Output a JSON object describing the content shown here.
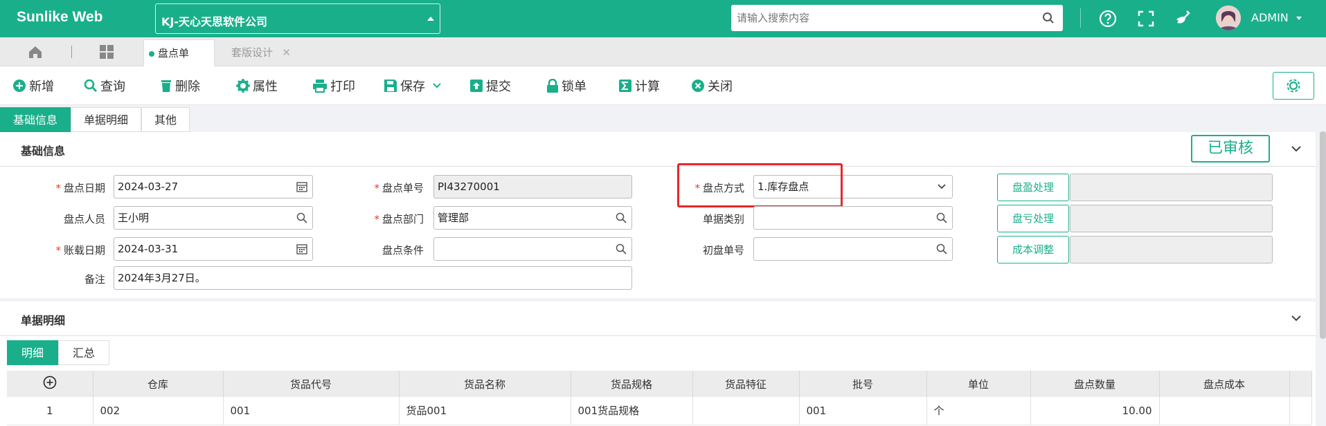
{
  "header": {
    "brand": "Sunlike Web",
    "company": "KJ-天心天思软件公司",
    "search_placeholder": "请输入搜索内容",
    "user": "ADMIN"
  },
  "tabs": [
    {
      "label": "盘点单"
    },
    {
      "label": "套版设计"
    }
  ],
  "toolbar": {
    "new": "新增",
    "query": "查询",
    "delete": "删除",
    "properties": "属性",
    "print": "打印",
    "save": "保存",
    "submit": "提交",
    "lock": "锁单",
    "calc": "计算",
    "close": "关闭"
  },
  "section_tabs": [
    "基础信息",
    "单据明细",
    "其他"
  ],
  "basic": {
    "title": "基础信息",
    "status": "已审核",
    "fields": {
      "count_date": {
        "label": "盘点日期",
        "value": "2024-03-27"
      },
      "count_no": {
        "label": "盘点单号",
        "value": "PI43270001"
      },
      "count_method": {
        "label": "盘点方式",
        "value": "1.库存盘点"
      },
      "counter": {
        "label": "盘点人员",
        "value": "王小明"
      },
      "count_dept": {
        "label": "盘点部门",
        "value": "管理部"
      },
      "doc_type": {
        "label": "单据类别",
        "value": ""
      },
      "post_date": {
        "label": "账载日期",
        "value": "2024-03-31"
      },
      "condition": {
        "label": "盘点条件",
        "value": ""
      },
      "initial_no": {
        "label": "初盘单号",
        "value": ""
      },
      "remark": {
        "label": "备注",
        "value": "2024年3月27日。"
      }
    },
    "buttons": {
      "surplus": "盘盈处理",
      "loss": "盘亏处理",
      "cost": "成本调整"
    }
  },
  "detail": {
    "title": "单据明细",
    "subtabs": [
      "明细",
      "汇总"
    ],
    "columns": [
      "仓库",
      "货品代号",
      "货品名称",
      "货品规格",
      "货品特征",
      "批号",
      "单位",
      "盘点数量",
      "盘点成本"
    ],
    "rows": [
      {
        "idx": "1",
        "warehouse": "002",
        "code": "001",
        "name": "货品001",
        "spec": "001货品规格",
        "feature": "",
        "batch": "001",
        "unit": "个",
        "qty": "10.00",
        "cost": ""
      }
    ]
  },
  "colors": {
    "accent": "#1aaf8b",
    "required": "#e0412b",
    "highlight": "#e5262c"
  }
}
